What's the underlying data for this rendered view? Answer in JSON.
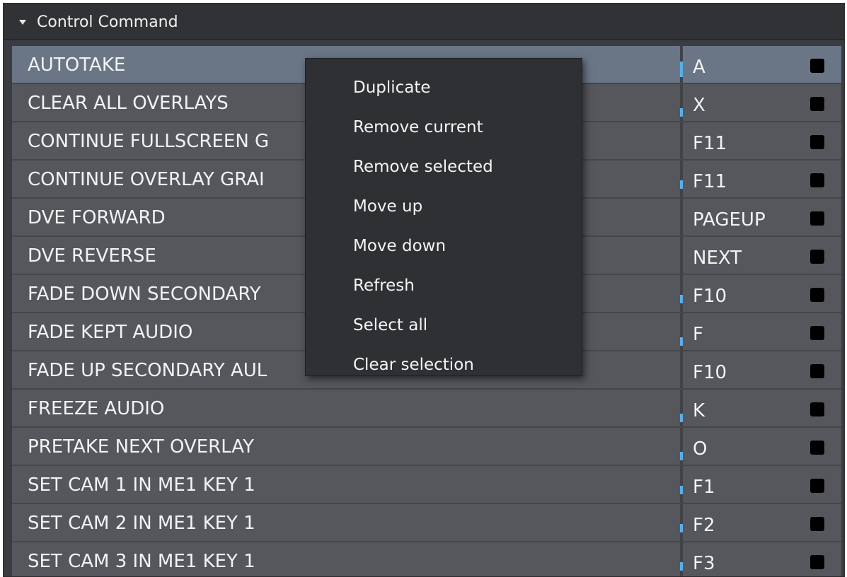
{
  "panel": {
    "title": "Control Command"
  },
  "rows": [
    {
      "name": "AUTOTAKE",
      "key": "A",
      "tick": "full",
      "selected": true
    },
    {
      "name": "CLEAR ALL OVERLAYS",
      "key": "X",
      "tick": "low",
      "selected": false
    },
    {
      "name": "CONTINUE FULLSCREEN G",
      "key": "F11",
      "tick": "none",
      "selected": false
    },
    {
      "name": "CONTINUE OVERLAY GRAI",
      "key": "F11",
      "tick": "mid",
      "selected": false
    },
    {
      "name": "DVE FORWARD",
      "key": "PAGEUP",
      "tick": "none",
      "selected": false
    },
    {
      "name": "DVE REVERSE",
      "key": "NEXT",
      "tick": "none",
      "selected": false
    },
    {
      "name": "FADE DOWN SECONDARY",
      "key": "F10",
      "tick": "mid",
      "selected": false
    },
    {
      "name": "FADE KEPT AUDIO",
      "key": "F",
      "tick": "low",
      "selected": false
    },
    {
      "name": "FADE UP SECONDARY AUL",
      "key": "F10",
      "tick": "none",
      "selected": false
    },
    {
      "name": "FREEZE AUDIO",
      "key": "K",
      "tick": "low",
      "selected": false
    },
    {
      "name": "PRETAKE NEXT OVERLAY",
      "key": "O",
      "tick": "low",
      "selected": false
    },
    {
      "name": "SET CAM 1 IN ME1 KEY 1",
      "key": "F1",
      "tick": "mid",
      "selected": false
    },
    {
      "name": "SET CAM 2 IN ME1 KEY 1",
      "key": "F2",
      "tick": "mid",
      "selected": false
    },
    {
      "name": "SET CAM 3 IN ME1 KEY 1",
      "key": "F3",
      "tick": "mid",
      "selected": false
    }
  ],
  "context_menu": {
    "items": [
      {
        "id": "duplicate",
        "label": "Duplicate"
      },
      {
        "id": "remove-current",
        "label": "Remove current"
      },
      {
        "id": "remove-selected",
        "label": "Remove selected"
      },
      {
        "id": "move-up",
        "label": "Move up"
      },
      {
        "id": "move-down",
        "label": "Move down"
      },
      {
        "id": "refresh",
        "label": "Refresh"
      },
      {
        "id": "select-all",
        "label": "Select all"
      },
      {
        "id": "clear-selection",
        "label": "Clear selection"
      }
    ]
  },
  "colors": {
    "panel_bg": "#3a3c41",
    "row_bg": "#55575c",
    "selected_row_bg": "#6a7686",
    "menu_bg": "#2e3034",
    "accent_tick": "#5aaee8",
    "text": "#f2f2f2"
  },
  "icons": {
    "collapse": "triangle-down-icon",
    "row_indicator": "black-square-indicator"
  }
}
